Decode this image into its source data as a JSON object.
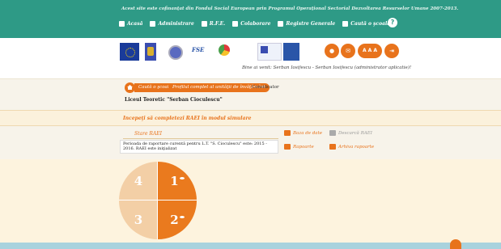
{
  "header": {
    "funding_text": "Acest site este cofinanţat din Fondul Social European prin Programul Operaţional Sectorial Dezvoltarea Resurselor Umane 2007-2013.",
    "nav": [
      {
        "label": "Acasă",
        "icon": "home-icon"
      },
      {
        "label": "Administrare",
        "icon": "admin-icon"
      },
      {
        "label": "R.F.E.",
        "icon": "document-icon"
      },
      {
        "label": "Colaborare",
        "icon": "collaboration-icon"
      },
      {
        "label": "Registre Generale",
        "icon": "registry-icon"
      },
      {
        "label": "Caută o şcoală",
        "icon": "search-icon"
      }
    ],
    "help_label": "?"
  },
  "user_bar": {
    "welcome": "Bine ai venit: Serban Iosifescu - Serban Iosifescu (administrator aplicatie)!",
    "font_size_label": "A A A"
  },
  "breadcrumb": {
    "items": [
      "Caută o şcoală",
      "Profilul complet al unităţii de învăţământ"
    ],
    "current": "Consilicator",
    "school": "Liceul Teoretic \"Serban Cioculescu\""
  },
  "notice": {
    "text": "Incepeţi să completezi RAEI în modul simulare"
  },
  "status": {
    "label": "Stare RAEI",
    "period_text": "Perioada de raportare curentă pentru L.T. \"S. Cioculescu\" este: 2015 - 2016. RAEI este iniţializat",
    "links": {
      "baza": "Baza de date",
      "descarca": "Descarcă RAEI",
      "rapoarte": "Rapoarte",
      "arhiva": "Arhiva rapoarte"
    }
  },
  "quadrants": {
    "q1": "1",
    "q2": "2",
    "q3": "3",
    "q4": "4"
  },
  "colors": {
    "primary": "#2e9a86",
    "accent": "#e8731c"
  }
}
